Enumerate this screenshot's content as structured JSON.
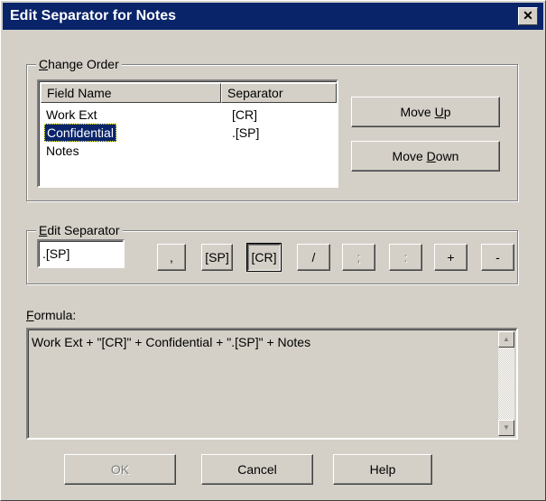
{
  "window": {
    "title": "Edit Separator for Notes",
    "close_glyph": "✕"
  },
  "change_order": {
    "group_label_mnemonic": "C",
    "group_label_rest": "hange Order",
    "columns": [
      "Field Name",
      "Separator"
    ],
    "rows": [
      {
        "field": "Work Ext",
        "separator": "[CR]"
      },
      {
        "field": "Confidential",
        "separator": ".[SP]"
      },
      {
        "field": "Notes",
        "separator": ""
      }
    ],
    "move_up": {
      "pre": "Move ",
      "mnemonic": "U",
      "post": "p"
    },
    "move_down": {
      "pre": "Move ",
      "mnemonic": "D",
      "post": "own"
    }
  },
  "edit_separator": {
    "group_label_mnemonic": "E",
    "group_label_rest": "dit Separator",
    "value": ".[SP]",
    "buttons": [
      ",",
      "[SP]",
      "[CR]",
      "/",
      ";",
      ":",
      "+",
      "-"
    ]
  },
  "formula": {
    "label_mnemonic": "F",
    "label_rest": "ormula:",
    "text": "Work Ext + \"[CR]\" + Confidential + \".[SP]\" + Notes"
  },
  "footer": {
    "ok": "OK",
    "cancel": "Cancel",
    "help": "Help"
  },
  "icons": {
    "scroll_up": "▲",
    "scroll_down": "▼"
  }
}
